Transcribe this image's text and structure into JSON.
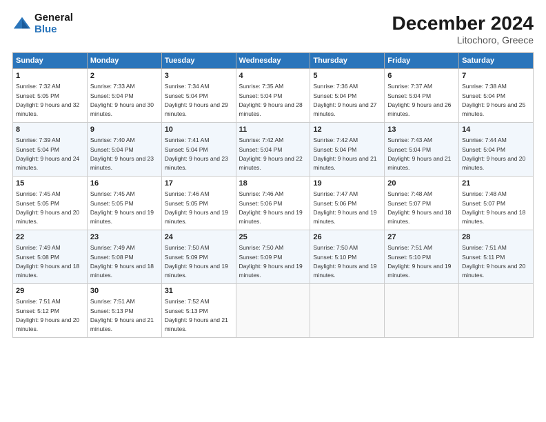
{
  "header": {
    "logo_line1": "General",
    "logo_line2": "Blue",
    "month": "December 2024",
    "location": "Litochoro, Greece"
  },
  "weekdays": [
    "Sunday",
    "Monday",
    "Tuesday",
    "Wednesday",
    "Thursday",
    "Friday",
    "Saturday"
  ],
  "weeks": [
    [
      {
        "day": "1",
        "rise": "7:32 AM",
        "set": "5:05 PM",
        "daylight": "9 hours and 32 minutes."
      },
      {
        "day": "2",
        "rise": "7:33 AM",
        "set": "5:04 PM",
        "daylight": "9 hours and 30 minutes."
      },
      {
        "day": "3",
        "rise": "7:34 AM",
        "set": "5:04 PM",
        "daylight": "9 hours and 29 minutes."
      },
      {
        "day": "4",
        "rise": "7:35 AM",
        "set": "5:04 PM",
        "daylight": "9 hours and 28 minutes."
      },
      {
        "day": "5",
        "rise": "7:36 AM",
        "set": "5:04 PM",
        "daylight": "9 hours and 27 minutes."
      },
      {
        "day": "6",
        "rise": "7:37 AM",
        "set": "5:04 PM",
        "daylight": "9 hours and 26 minutes."
      },
      {
        "day": "7",
        "rise": "7:38 AM",
        "set": "5:04 PM",
        "daylight": "9 hours and 25 minutes."
      }
    ],
    [
      {
        "day": "8",
        "rise": "7:39 AM",
        "set": "5:04 PM",
        "daylight": "9 hours and 24 minutes."
      },
      {
        "day": "9",
        "rise": "7:40 AM",
        "set": "5:04 PM",
        "daylight": "9 hours and 23 minutes."
      },
      {
        "day": "10",
        "rise": "7:41 AM",
        "set": "5:04 PM",
        "daylight": "9 hours and 23 minutes."
      },
      {
        "day": "11",
        "rise": "7:42 AM",
        "set": "5:04 PM",
        "daylight": "9 hours and 22 minutes."
      },
      {
        "day": "12",
        "rise": "7:42 AM",
        "set": "5:04 PM",
        "daylight": "9 hours and 21 minutes."
      },
      {
        "day": "13",
        "rise": "7:43 AM",
        "set": "5:04 PM",
        "daylight": "9 hours and 21 minutes."
      },
      {
        "day": "14",
        "rise": "7:44 AM",
        "set": "5:04 PM",
        "daylight": "9 hours and 20 minutes."
      }
    ],
    [
      {
        "day": "15",
        "rise": "7:45 AM",
        "set": "5:05 PM",
        "daylight": "9 hours and 20 minutes."
      },
      {
        "day": "16",
        "rise": "7:45 AM",
        "set": "5:05 PM",
        "daylight": "9 hours and 19 minutes."
      },
      {
        "day": "17",
        "rise": "7:46 AM",
        "set": "5:05 PM",
        "daylight": "9 hours and 19 minutes."
      },
      {
        "day": "18",
        "rise": "7:46 AM",
        "set": "5:06 PM",
        "daylight": "9 hours and 19 minutes."
      },
      {
        "day": "19",
        "rise": "7:47 AM",
        "set": "5:06 PM",
        "daylight": "9 hours and 19 minutes."
      },
      {
        "day": "20",
        "rise": "7:48 AM",
        "set": "5:07 PM",
        "daylight": "9 hours and 18 minutes."
      },
      {
        "day": "21",
        "rise": "7:48 AM",
        "set": "5:07 PM",
        "daylight": "9 hours and 18 minutes."
      }
    ],
    [
      {
        "day": "22",
        "rise": "7:49 AM",
        "set": "5:08 PM",
        "daylight": "9 hours and 18 minutes."
      },
      {
        "day": "23",
        "rise": "7:49 AM",
        "set": "5:08 PM",
        "daylight": "9 hours and 18 minutes."
      },
      {
        "day": "24",
        "rise": "7:50 AM",
        "set": "5:09 PM",
        "daylight": "9 hours and 19 minutes."
      },
      {
        "day": "25",
        "rise": "7:50 AM",
        "set": "5:09 PM",
        "daylight": "9 hours and 19 minutes."
      },
      {
        "day": "26",
        "rise": "7:50 AM",
        "set": "5:10 PM",
        "daylight": "9 hours and 19 minutes."
      },
      {
        "day": "27",
        "rise": "7:51 AM",
        "set": "5:10 PM",
        "daylight": "9 hours and 19 minutes."
      },
      {
        "day": "28",
        "rise": "7:51 AM",
        "set": "5:11 PM",
        "daylight": "9 hours and 20 minutes."
      }
    ],
    [
      {
        "day": "29",
        "rise": "7:51 AM",
        "set": "5:12 PM",
        "daylight": "9 hours and 20 minutes."
      },
      {
        "day": "30",
        "rise": "7:51 AM",
        "set": "5:13 PM",
        "daylight": "9 hours and 21 minutes."
      },
      {
        "day": "31",
        "rise": "7:52 AM",
        "set": "5:13 PM",
        "daylight": "9 hours and 21 minutes."
      },
      null,
      null,
      null,
      null
    ]
  ]
}
